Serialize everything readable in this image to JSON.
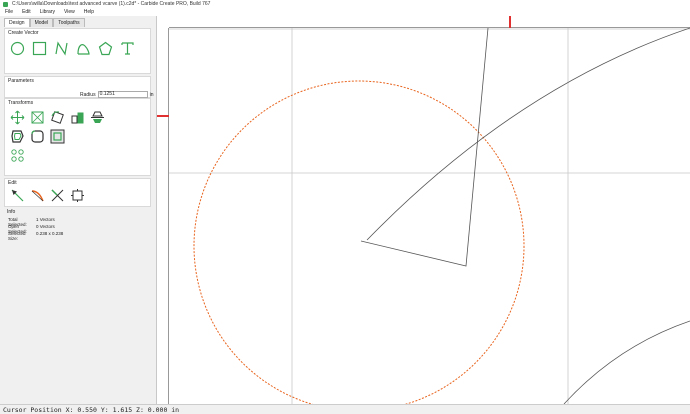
{
  "window": {
    "title": "C:\\Users\\willa\\Downloads\\test advanced vcarve (1).c2d* - Carbide Create PRO, Build 767"
  },
  "menu": [
    "File",
    "Edit",
    "Library",
    "View",
    "Help"
  ],
  "tabs": [
    {
      "label": "Design",
      "active": true
    },
    {
      "label": "Model",
      "active": false
    },
    {
      "label": "Toolpaths",
      "active": false
    }
  ],
  "create_vector": {
    "title": "Create Vector",
    "tools": [
      "circle-icon",
      "rectangle-icon",
      "polyline-icon",
      "curve-icon",
      "polygon-icon",
      "text-icon"
    ]
  },
  "parameters": {
    "title": "Parameters",
    "radius_label": "Radius",
    "radius_value": "0.1251",
    "radius_unit": "in"
  },
  "transforms": {
    "title": "Transforms",
    "rows": [
      [
        "move-icon",
        "scale-icon",
        "rotate-icon",
        "align-icon",
        "mirror-icon"
      ],
      [
        "offset-icon",
        "fillet-icon",
        "boolean-icon"
      ],
      [
        "array-icon"
      ]
    ]
  },
  "edit": {
    "title": "Edit",
    "tools": [
      "node-edit-icon",
      "curve-edit-icon",
      "trim-icon",
      "bounding-box-icon"
    ]
  },
  "info": {
    "title": "Info",
    "total_selected_label": "Total Selected:",
    "total_selected_value": "1 Vectors",
    "open_selected_label": "Open Selected:",
    "open_selected_value": "0 Vectors",
    "selected_size_label": "Selected Size:",
    "selected_size_value": "0.238 x 0.238"
  },
  "status": {
    "text": "Cursor Position X: 0.550 Y: 1.615 Z: 0.000 in"
  },
  "colors": {
    "accent": "#3aa655",
    "selection": "#e8641e",
    "marker": "#e03030",
    "grid": "#c8c8c8",
    "vector": "#555555"
  }
}
